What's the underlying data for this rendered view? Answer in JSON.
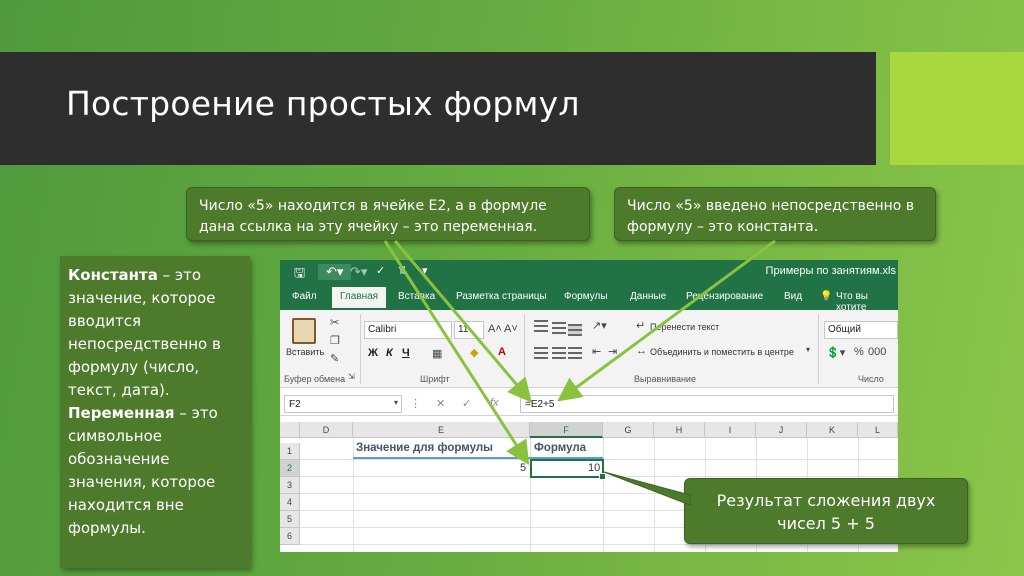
{
  "slide": {
    "title": "Построение простых формул",
    "callouts": {
      "variable": "Число «5» находится в ячейке E2, а в формуле дана ссылка на эту ячейку – это переменная.",
      "constant": "Число «5» введено непосредственно в формулу – это константа.",
      "result": "Результат сложения двух чисел 5 + 5"
    },
    "definition": {
      "constant_term": "Константа",
      "constant_text": " – это значение, которое вводится непосредственно в формулу (число, текст, дата).",
      "variable_term": "Переменная",
      "variable_text": " – это символьное обозначение значения, которое находится вне формулы."
    },
    "colors": {
      "title_bar": "#2e2e2e",
      "accent": "#a7d93f",
      "callout_bg": "#4e7a2c",
      "excel_green": "#217346",
      "arrow": "#8ac23f"
    }
  },
  "excel": {
    "file_title": "Примеры по занятиям.xls",
    "menu": [
      "Файл",
      "Главная",
      "Вставка",
      "Разметка страницы",
      "Формулы",
      "Данные",
      "Рецензирование",
      "Вид",
      "Что вы хотите"
    ],
    "ribbon": {
      "paste_label": "Вставить",
      "font_name": "Calibri",
      "font_size": "11",
      "bold": "Ж",
      "italic": "К",
      "underline": "Ч",
      "wrap_text": "Перенести текст",
      "merge_center": "Объединить и поместить в центре",
      "number_format": "Общий",
      "group_clipboard": "Буфер обмена",
      "group_font": "Шрифт",
      "group_alignment": "Выравнивание",
      "group_number": "Число"
    },
    "name_box": "F2",
    "formula": "=E2+5",
    "columns": [
      "D",
      "E",
      "F",
      "G",
      "H",
      "I",
      "J",
      "K",
      "L"
    ],
    "rows": [
      "1",
      "2",
      "3",
      "4",
      "5",
      "6"
    ],
    "cells": {
      "E1": "Значение для формулы",
      "F1": "Формула",
      "E2": "5",
      "F2": "10"
    }
  }
}
